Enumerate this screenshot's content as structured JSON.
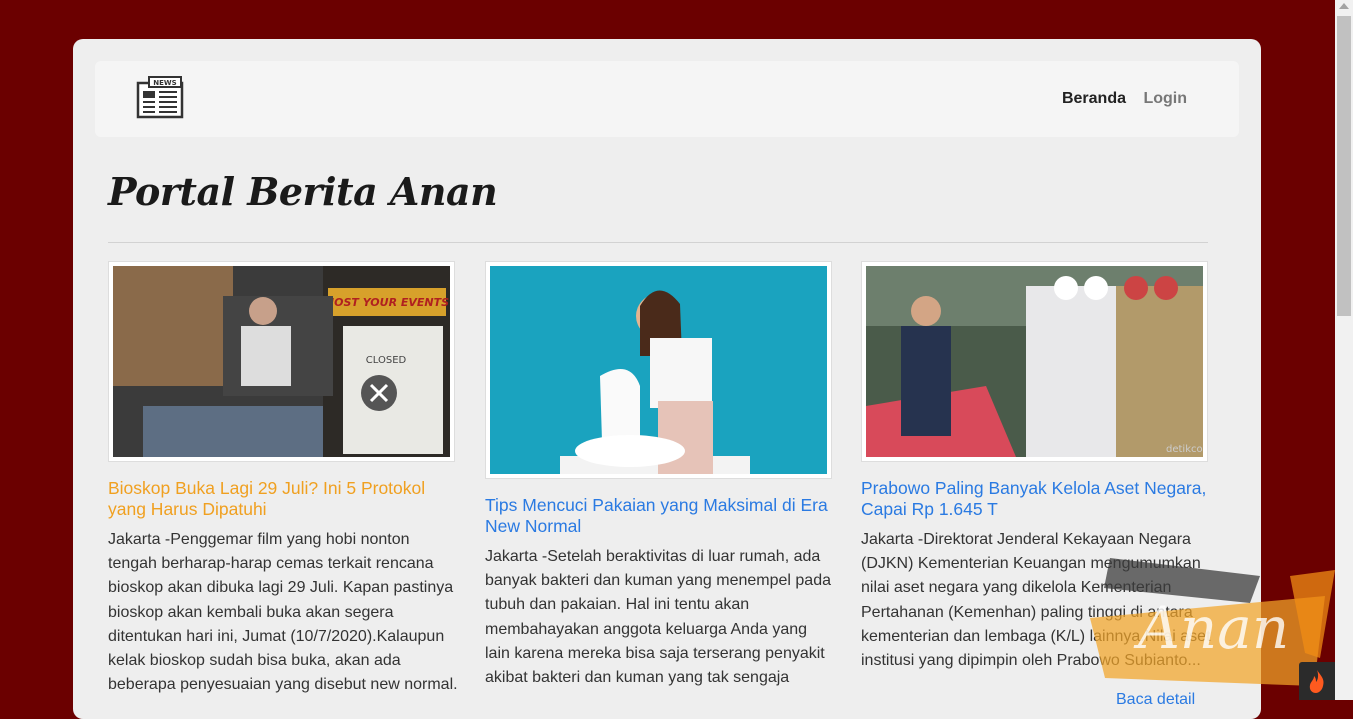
{
  "nav": {
    "home": "Beranda",
    "login": "Login"
  },
  "page_title": "Portal Berita Anan",
  "articles": [
    {
      "title": "Bioskop Buka Lagi 29 Juli? Ini 5 Protokol yang Harus Dipatuhi",
      "image_sign": "CLOSED",
      "banner": "HOST YOUR EVENTS",
      "body": "Jakarta -Penggemar film yang hobi nonton tengah berharap-harap cemas terkait rencana bioskop akan dibuka lagi 29 Juli. Kapan pastinya bioskop akan kembali buka akan segera ditentukan hari ini, Jumat (10/7/2020).Kalaupun kelak bioskop sudah bisa buka, akan ada beberapa penyesuaian yang disebut new normal."
    },
    {
      "title": "Tips Mencuci Pakaian yang Maksimal di Era New Normal",
      "body": "Jakarta -Setelah beraktivitas di luar rumah, ada banyak bakteri dan kuman yang menempel pada tubuh dan pakaian. Hal ini tentu akan membahayakan anggota keluarga Anda yang lain karena mereka bisa saja terserang penyakit akibat bakteri dan kuman yang tak sengaja"
    },
    {
      "title": "Prabowo Paling Banyak Kelola Aset Negara, Capai Rp 1.645 T",
      "image_credit": "detikcom",
      "body": "Jakarta -Direktorat Jenderal Kekayaan Negara (DJKN) Kementerian Keuangan mengumumkan nilai aset negara yang dikelola Kementerian Pertahanan (Kemenhan) paling tinggi di antara kementerian dan lembaga (K/L) lainnya.Nilai aset institusi yang dipimpin oleh Prabowo Subianto..."
    }
  ],
  "read_more": "Baca detail",
  "watermark": "Anan",
  "logo_text": "NEWS"
}
